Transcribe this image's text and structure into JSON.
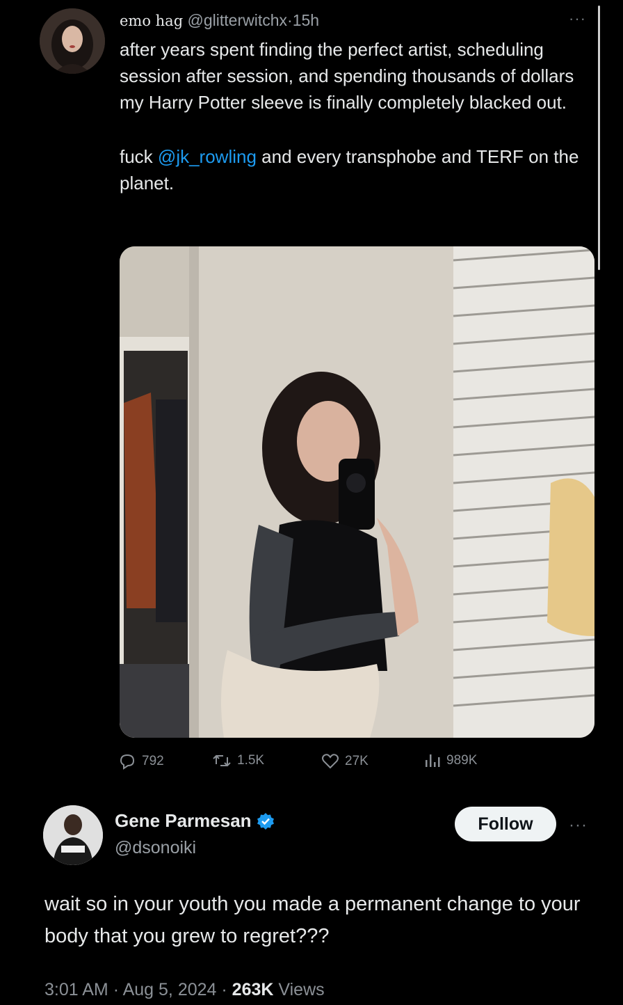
{
  "tweet": {
    "display_name": "emo hag",
    "handle": "@glitterwitchx",
    "separator": "·",
    "time": "15h",
    "more": "···",
    "text_line1": "after years spent finding the perfect artist, scheduling session after session, and spending thousands of dollars my Harry Potter sleeve is finally completely blacked out.",
    "text_line2_before": "fuck ",
    "text_line2_mention": "@jk_rowling",
    "text_line2_after": " and every transphobe and TERF on the planet.",
    "stats": {
      "replies": "792",
      "reposts": "1.5K",
      "likes": "27K",
      "views": "989K"
    }
  },
  "reply": {
    "display_name": "Gene Parmesan",
    "handle": "@dsonoiki",
    "follow_label": "Follow",
    "more": "···",
    "text": "wait so in your youth you made a permanent change to your body that you grew to regret???",
    "time": "3:01 AM",
    "date": "Aug 5, 2024",
    "separator": "·",
    "views_count": "263K",
    "views_label": "Views"
  },
  "colors": {
    "background": "#000000",
    "text": "#e7e9ea",
    "muted": "#8b9096",
    "mention": "#1d9bf0",
    "verified": "#1d9bf0",
    "follow_bg": "#eff3f4"
  }
}
